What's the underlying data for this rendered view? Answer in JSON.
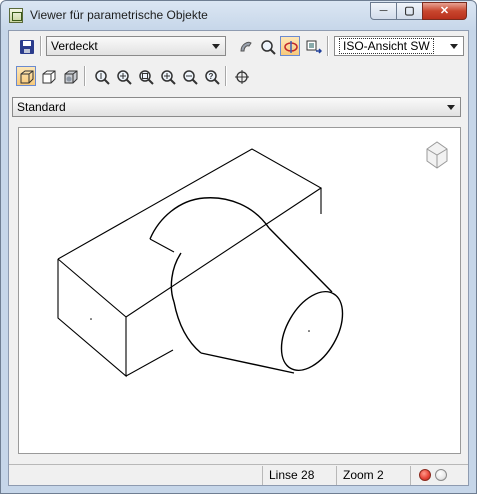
{
  "window": {
    "title": "Viewer für parametrische Objekte",
    "min_label": "─",
    "max_label": "▢",
    "close_label": "✕"
  },
  "toolbar1": {
    "display_mode": "Verdeckt",
    "view": "ISO-Ansicht SW",
    "icons": [
      "save-icon",
      "shade-icon",
      "zoom-icon",
      "orbit-icon",
      "insert-view-icon"
    ]
  },
  "toolbar2": {
    "icons": [
      "visual-style-wireframe-icon",
      "visual-style-hidden-icon",
      "visual-style-realistic-icon",
      "zoom-realtime-icon",
      "zoom-in-icon",
      "zoom-window-icon",
      "zoom-extents-icon",
      "zoom-out-icon",
      "zoom-previous-icon",
      "locate-icon"
    ]
  },
  "style_selector": {
    "value": "Standard"
  },
  "status": {
    "linse": "Linse 28",
    "zoom": "Zoom 2"
  },
  "colors": {
    "status_red": "#e8463a",
    "status_off": "#e8e8e8"
  }
}
